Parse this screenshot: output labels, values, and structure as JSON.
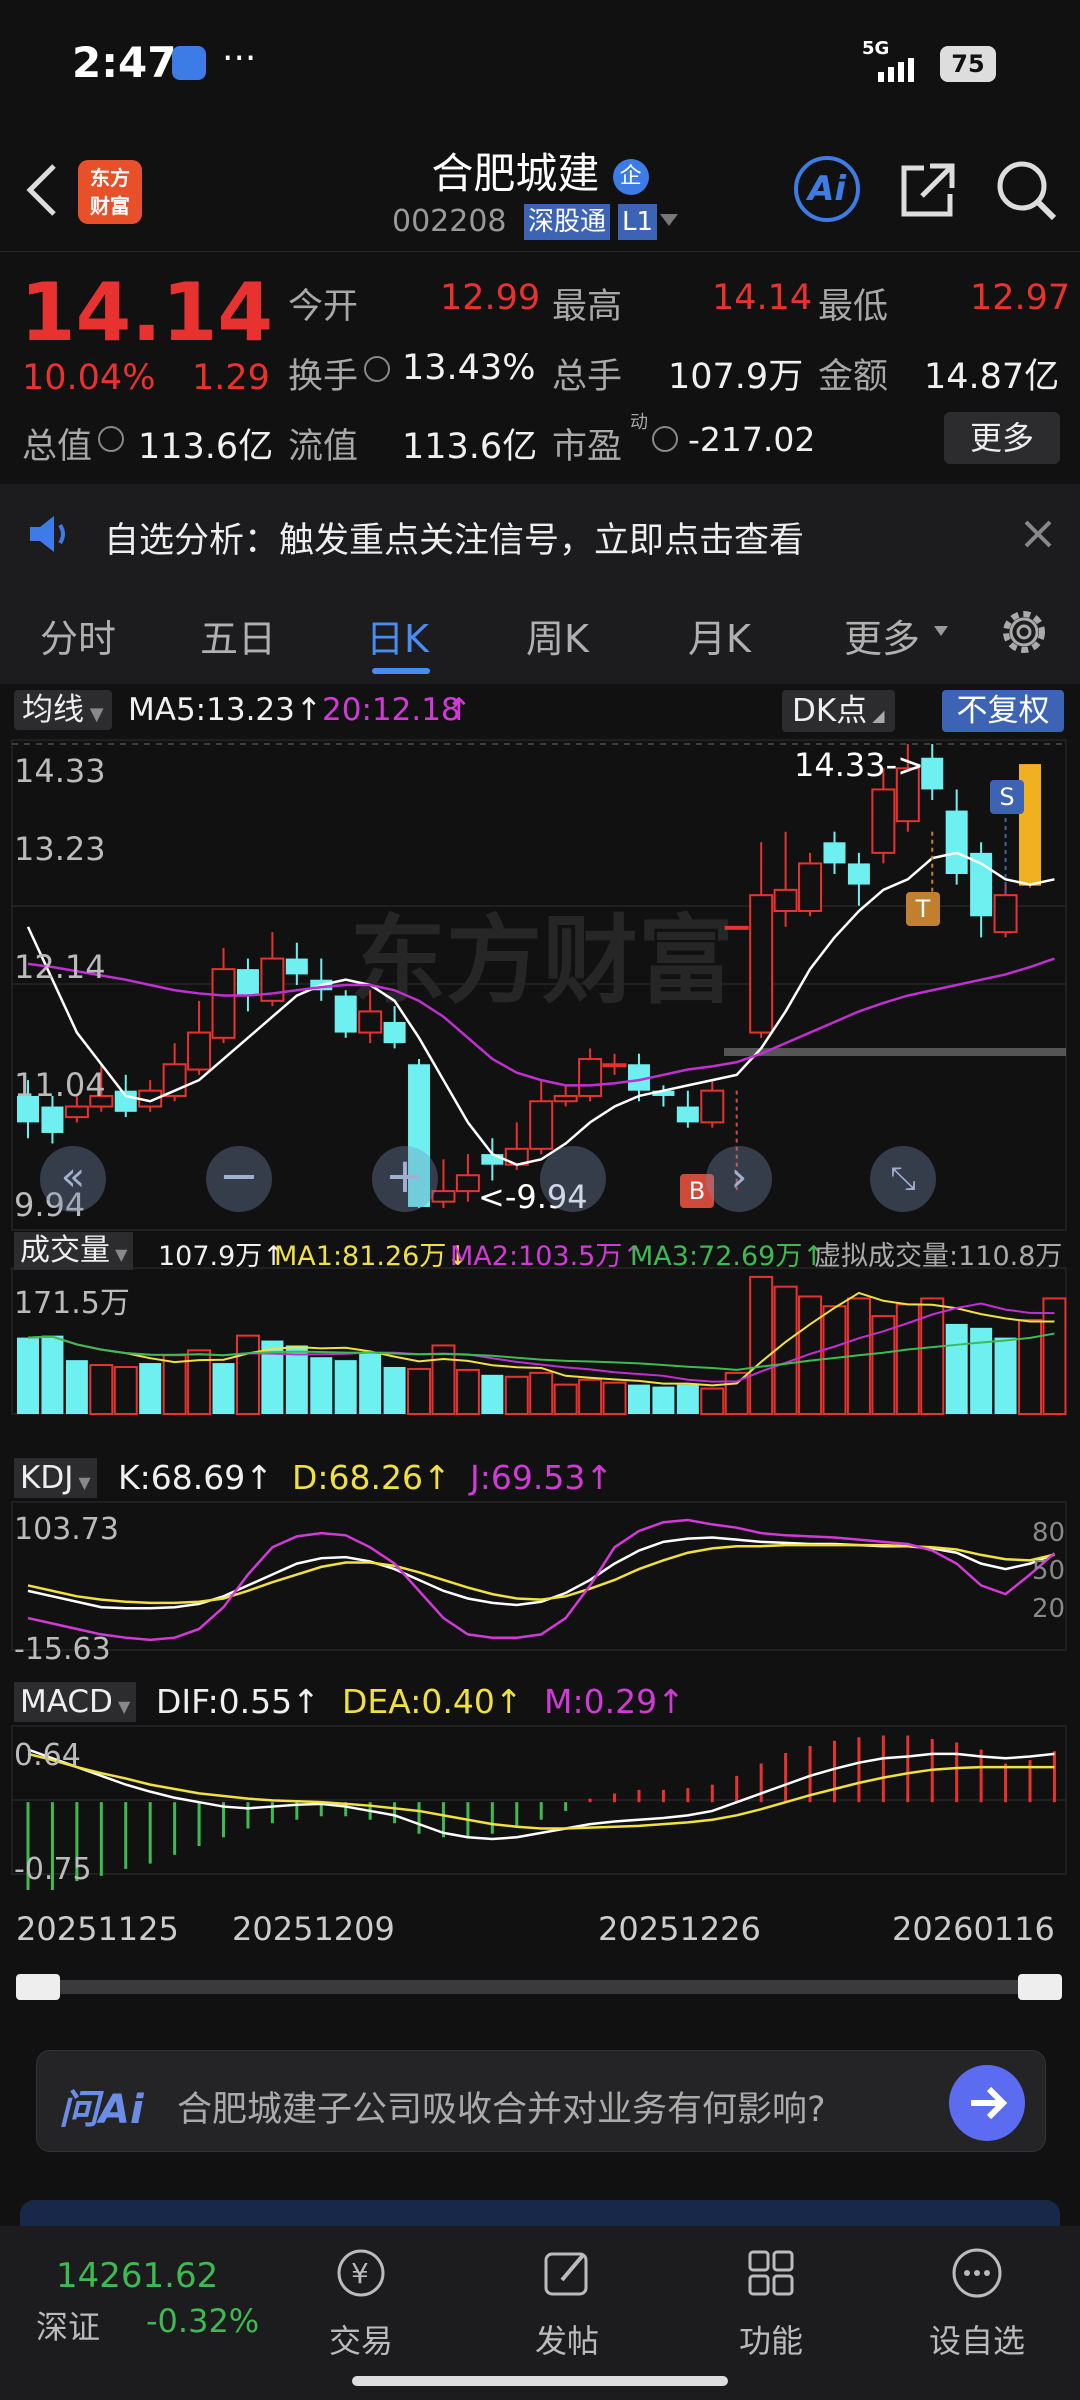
{
  "status": {
    "time": "2:47",
    "signal": "5G",
    "battery": "75"
  },
  "header": {
    "title": "合肥城建",
    "badge": "企",
    "code": "002208",
    "tag1": "深股通",
    "tag2": "L1",
    "logo_line1": "东方",
    "logo_line2": "财富",
    "ai": "Ai"
  },
  "quote": {
    "price": "14.14",
    "pct": "10.04%",
    "chg": "1.29",
    "open_label": "今开",
    "open": "12.99",
    "high_label": "最高",
    "high": "14.14",
    "low_label": "最低",
    "low": "12.97",
    "turnover_label": "换手",
    "turnover": "13.43%",
    "vol_label": "总手",
    "vol": "107.9万",
    "amount_label": "金额",
    "amount": "14.87亿",
    "mcap_label": "总值",
    "mcap": "113.6亿",
    "float_label": "流值",
    "float": "113.6亿",
    "pe_label": "市盈",
    "pe_sup": "动",
    "pe": "-217.02",
    "more": "更多"
  },
  "banner": {
    "text": "自选分析：触发重点关注信号，立即点击查看"
  },
  "tabs": [
    "分时",
    "五日",
    "日K",
    "周K",
    "月K",
    "更多"
  ],
  "main_chart": {
    "indicator": "均线",
    "ma5": "MA5:13.23",
    "ma20": "20:12.18",
    "dk": "DK点",
    "fq": "不复权",
    "y_labels": [
      "14.33",
      "13.23",
      "12.14",
      "11.04",
      "9.94"
    ],
    "high_note": "14.33->",
    "low_note": "<-9.94",
    "watermark": "东方财富",
    "marker_b": "B",
    "marker_t": "T",
    "marker_s": "S"
  },
  "volume": {
    "label": "成交量",
    "v": "107.9万",
    "ma1": "MA1:81.26万",
    "ma2": "MA2:103.5万",
    "ma3": "MA3:72.69万",
    "virtual": "虚拟成交量:110.8万",
    "top": "171.5万"
  },
  "kdj": {
    "label": "KDJ",
    "k": "K:68.69",
    "d": "D:68.26",
    "j": "J:69.53",
    "top": "103.73",
    "bottom": "-15.63",
    "r80": "80",
    "r50": "50",
    "r20": "20"
  },
  "macd": {
    "label": "MACD",
    "dif": "DIF:0.55",
    "dea": "DEA:0.40",
    "m": "M:0.29",
    "top": "0.64",
    "bottom": "-0.75"
  },
  "dates": [
    "20251125",
    "20251209",
    "20251226",
    "20260116"
  ],
  "ask": {
    "brand": "问Ai",
    "question": "合肥城建子公司吸收合并对业务有何影响?"
  },
  "dock": {
    "index_value": "14261.62",
    "index_name": "深证",
    "index_pct": "-0.32%",
    "items": [
      "交易",
      "发帖",
      "功能",
      "设自选"
    ]
  },
  "chart_data": {
    "type": "candlestick",
    "candles": [
      {
        "o": 11.0,
        "c": 10.75,
        "h": 11.15,
        "l": 10.6
      },
      {
        "o": 10.9,
        "c": 10.65,
        "h": 11.0,
        "l": 10.55
      },
      {
        "o": 10.8,
        "c": 10.9,
        "h": 11.0,
        "l": 10.75
      },
      {
        "o": 10.9,
        "c": 11.0,
        "h": 11.3,
        "l": 10.85
      },
      {
        "o": 11.05,
        "c": 10.85,
        "h": 11.2,
        "l": 10.8
      },
      {
        "o": 10.9,
        "c": 11.05,
        "h": 11.15,
        "l": 10.85
      },
      {
        "o": 11.0,
        "c": 11.3,
        "h": 11.5,
        "l": 10.95
      },
      {
        "o": 11.25,
        "c": 11.6,
        "h": 11.9,
        "l": 11.2
      },
      {
        "o": 11.55,
        "c": 12.2,
        "h": 12.4,
        "l": 11.5
      },
      {
        "o": 12.2,
        "c": 11.95,
        "h": 12.3,
        "l": 11.8
      },
      {
        "o": 11.9,
        "c": 12.3,
        "h": 12.55,
        "l": 11.85
      },
      {
        "o": 12.3,
        "c": 12.15,
        "h": 12.45,
        "l": 12.05
      },
      {
        "o": 12.1,
        "c": 12.0,
        "h": 12.3,
        "l": 11.9
      },
      {
        "o": 11.95,
        "c": 11.6,
        "h": 12.0,
        "l": 11.55
      },
      {
        "o": 11.6,
        "c": 11.8,
        "h": 12.0,
        "l": 11.5
      },
      {
        "o": 11.7,
        "c": 11.5,
        "h": 11.85,
        "l": 11.45
      },
      {
        "o": 11.3,
        "c": 9.95,
        "h": 11.35,
        "l": 9.94
      },
      {
        "o": 10.0,
        "c": 10.1,
        "h": 10.4,
        "l": 9.94
      },
      {
        "o": 10.1,
        "c": 10.25,
        "h": 10.45,
        "l": 10.0
      },
      {
        "o": 10.45,
        "c": 10.35,
        "h": 10.6,
        "l": 10.2
      },
      {
        "o": 10.35,
        "c": 10.5,
        "h": 10.75,
        "l": 10.3
      },
      {
        "o": 10.5,
        "c": 10.95,
        "h": 11.15,
        "l": 10.45
      },
      {
        "o": 10.95,
        "c": 11.0,
        "h": 11.1,
        "l": 10.9
      },
      {
        "o": 11.0,
        "c": 11.35,
        "h": 11.45,
        "l": 10.95
      },
      {
        "o": 11.3,
        "c": 11.3,
        "h": 11.4,
        "l": 11.2
      },
      {
        "o": 11.3,
        "c": 11.05,
        "h": 11.4,
        "l": 10.95
      },
      {
        "o": 11.05,
        "c": 11.0,
        "h": 11.1,
        "l": 10.9
      },
      {
        "o": 10.9,
        "c": 10.75,
        "h": 11.05,
        "l": 10.7
      },
      {
        "o": 10.75,
        "c": 11.05,
        "h": 11.15,
        "l": 10.7
      },
      {
        "o": 12.6,
        "c": 12.6,
        "h": 12.6,
        "l": 12.6
      },
      {
        "o": 11.6,
        "c": 12.9,
        "h": 13.4,
        "l": 11.55
      },
      {
        "o": 12.75,
        "c": 12.95,
        "h": 13.5,
        "l": 12.6
      },
      {
        "o": 12.75,
        "c": 13.2,
        "h": 13.3,
        "l": 12.7
      },
      {
        "o": 13.4,
        "c": 13.2,
        "h": 13.5,
        "l": 13.1
      },
      {
        "o": 13.2,
        "c": 13.0,
        "h": 13.3,
        "l": 12.8
      },
      {
        "o": 13.3,
        "c": 13.9,
        "h": 14.1,
        "l": 13.2
      },
      {
        "o": 13.6,
        "c": 14.1,
        "h": 14.33,
        "l": 13.5
      },
      {
        "o": 14.2,
        "c": 13.9,
        "h": 14.33,
        "l": 13.8
      },
      {
        "o": 13.7,
        "c": 13.1,
        "h": 13.9,
        "l": 13.0
      },
      {
        "o": 13.3,
        "c": 12.7,
        "h": 13.4,
        "l": 12.5
      },
      {
        "o": 12.55,
        "c": 12.9,
        "h": 13.0,
        "l": 12.5
      },
      {
        "o": 12.99,
        "c": 14.14,
        "h": 14.14,
        "l": 12.97
      }
    ],
    "ma_white": [
      12.6,
      12.1,
      11.6,
      11.3,
      11.0,
      10.95,
      11.05,
      11.15,
      11.35,
      11.55,
      11.75,
      11.95,
      12.05,
      12.1,
      12.05,
      11.9,
      11.55,
      11.15,
      10.75,
      10.45,
      10.35,
      10.4,
      10.55,
      10.75,
      10.9,
      11.0,
      11.05,
      11.1,
      11.15,
      11.2,
      11.45,
      11.8,
      12.2,
      12.5,
      12.75,
      12.95,
      13.05,
      13.25,
      13.3,
      13.2,
      13.05,
      13.0,
      13.05
    ],
    "ma_purple": [
      12.25,
      12.22,
      12.18,
      12.14,
      12.1,
      12.05,
      12.0,
      11.97,
      11.95,
      11.95,
      11.97,
      12.0,
      12.03,
      12.05,
      12.05,
      12.0,
      11.9,
      11.75,
      11.55,
      11.35,
      11.22,
      11.15,
      11.1,
      11.1,
      11.12,
      11.15,
      11.2,
      11.25,
      11.28,
      11.32,
      11.4,
      11.5,
      11.6,
      11.7,
      11.8,
      11.88,
      11.95,
      12.0,
      12.05,
      12.1,
      12.15,
      12.22,
      12.3
    ],
    "volume": [
      78,
      80,
      55,
      50,
      48,
      52,
      60,
      65,
      52,
      80,
      75,
      70,
      58,
      55,
      62,
      48,
      46,
      70,
      45,
      40,
      38,
      42,
      30,
      35,
      32,
      30,
      28,
      30,
      26,
      42,
      140,
      130,
      120,
      110,
      118,
      100,
      112,
      118,
      92,
      88,
      78,
      96,
      118
    ],
    "volume_direction": [
      0,
      0,
      0,
      1,
      1,
      0,
      1,
      1,
      0,
      1,
      0,
      0,
      0,
      0,
      0,
      0,
      1,
      1,
      1,
      0,
      1,
      1,
      1,
      1,
      1,
      0,
      0,
      0,
      1,
      1,
      1,
      1,
      1,
      1,
      1,
      1,
      1,
      1,
      0,
      0,
      0,
      1,
      1
    ],
    "kdj_k": [
      35,
      30,
      25,
      20,
      19,
      19,
      20,
      23,
      30,
      40,
      50,
      60,
      65,
      66,
      62,
      55,
      45,
      35,
      28,
      24,
      22,
      25,
      33,
      45,
      60,
      72,
      80,
      83,
      84,
      82,
      80,
      79,
      78,
      78,
      77,
      76,
      76,
      74,
      70,
      60,
      55,
      60,
      68.69
    ],
    "kdj_d": [
      40,
      35,
      30,
      27,
      25,
      24,
      24,
      25,
      28,
      35,
      43,
      50,
      57,
      61,
      61,
      58,
      52,
      45,
      38,
      32,
      28,
      27,
      30,
      37,
      45,
      55,
      63,
      70,
      74,
      76,
      76,
      77,
      77,
      77,
      77,
      77,
      76,
      75,
      73,
      68,
      64,
      63,
      68.26
    ],
    "kdj_j": [
      10,
      5,
      0,
      -5,
      -8,
      -10,
      -8,
      0,
      20,
      50,
      75,
      85,
      88,
      86,
      75,
      60,
      35,
      10,
      -5,
      -8,
      -8,
      -5,
      10,
      40,
      75,
      90,
      98,
      100,
      96,
      93,
      88,
      86,
      85,
      84,
      82,
      80,
      78,
      72,
      60,
      40,
      32,
      50,
      69.53
    ],
    "macd_dif": [
      0.6,
      0.5,
      0.4,
      0.3,
      0.2,
      0.12,
      0.05,
      0.0,
      -0.05,
      -0.07,
      -0.05,
      -0.03,
      -0.02,
      -0.05,
      -0.1,
      -0.15,
      -0.25,
      -0.35,
      -0.4,
      -0.42,
      -0.4,
      -0.35,
      -0.3,
      -0.25,
      -0.22,
      -0.2,
      -0.18,
      -0.15,
      -0.1,
      0.0,
      0.1,
      0.2,
      0.3,
      0.38,
      0.45,
      0.5,
      0.52,
      0.55,
      0.55,
      0.52,
      0.5,
      0.52,
      0.55
    ],
    "macd_dea": [
      0.55,
      0.48,
      0.4,
      0.33,
      0.27,
      0.2,
      0.15,
      0.1,
      0.07,
      0.04,
      0.02,
      0.01,
      0.0,
      -0.02,
      -0.04,
      -0.07,
      -0.1,
      -0.15,
      -0.2,
      -0.25,
      -0.28,
      -0.3,
      -0.3,
      -0.29,
      -0.28,
      -0.27,
      -0.25,
      -0.23,
      -0.2,
      -0.15,
      -0.08,
      0.0,
      0.08,
      0.15,
      0.22,
      0.28,
      0.33,
      0.37,
      0.39,
      0.4,
      0.4,
      0.4,
      0.4
    ],
    "macd_m": [
      -0.5,
      -0.5,
      -0.45,
      -0.42,
      -0.38,
      -0.35,
      -0.3,
      -0.25,
      -0.2,
      -0.15,
      -0.12,
      -0.1,
      -0.08,
      -0.08,
      -0.1,
      -0.12,
      -0.18,
      -0.2,
      -0.2,
      -0.18,
      -0.14,
      -0.1,
      -0.05,
      0.02,
      0.05,
      0.07,
      0.07,
      0.08,
      0.1,
      0.15,
      0.22,
      0.28,
      0.32,
      0.35,
      0.37,
      0.38,
      0.38,
      0.36,
      0.34,
      0.3,
      0.22,
      0.24,
      0.29
    ]
  }
}
